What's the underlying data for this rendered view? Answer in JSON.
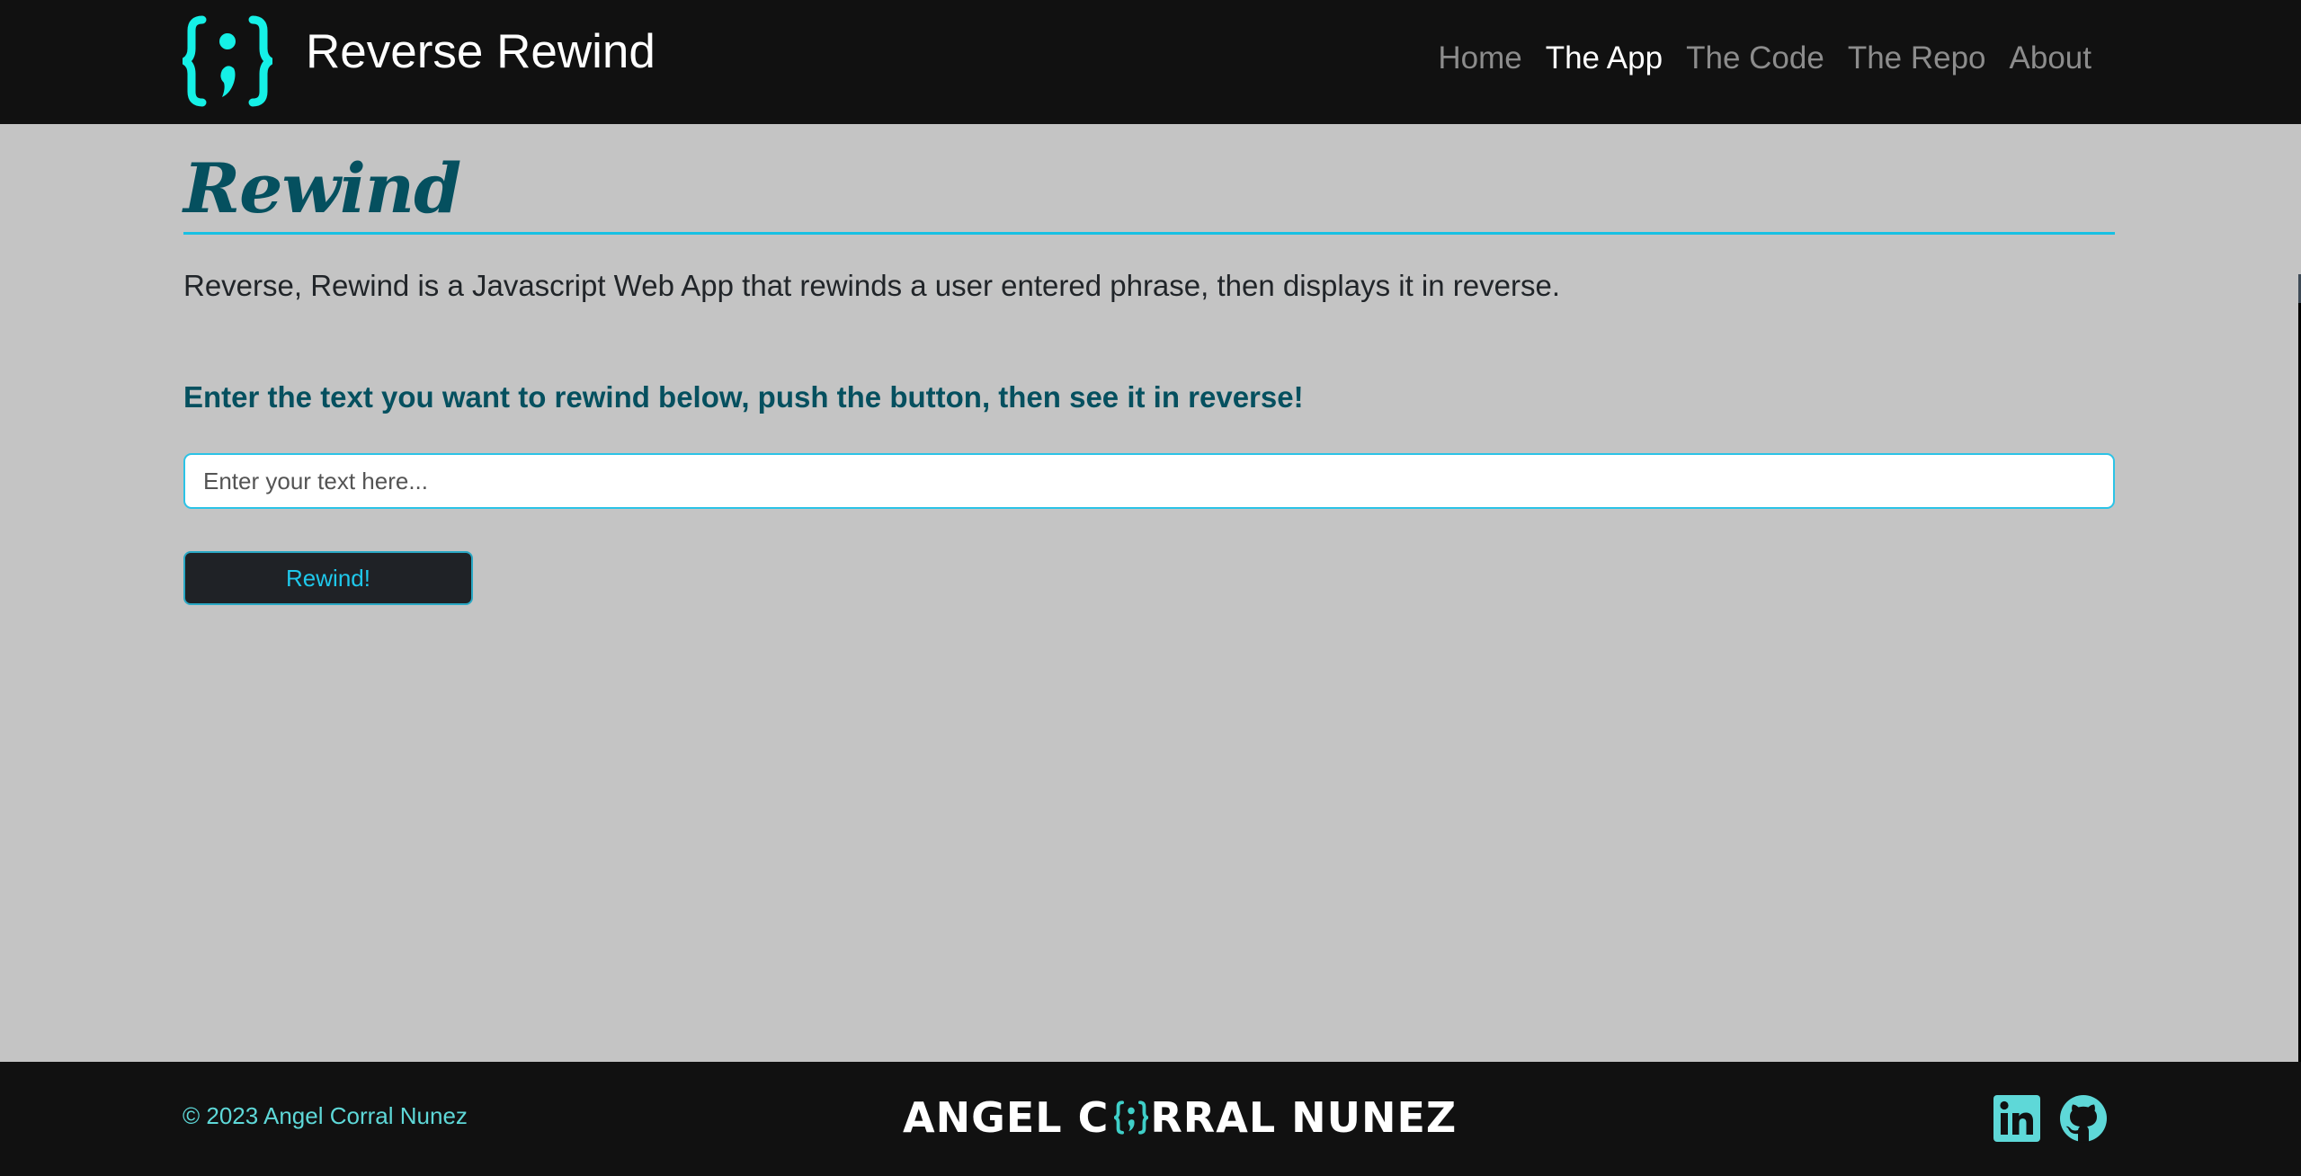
{
  "navbar": {
    "brand_name": "Reverse Rewind",
    "logo_icon": "curly-braces-semicolon-icon",
    "links": [
      {
        "label": "Home",
        "active": false
      },
      {
        "label": "The App",
        "active": true
      },
      {
        "label": "The Code",
        "active": false
      },
      {
        "label": "The Repo",
        "active": false
      },
      {
        "label": "About",
        "active": false
      }
    ]
  },
  "main": {
    "title": "Rewind",
    "intro": "Reverse, Rewind is a Javascript Web App that rewinds a user entered phrase, then displays it in reverse.",
    "prompt": "Enter the text you want to rewind below, push the button, then see it in reverse!",
    "input": {
      "value": "",
      "placeholder": "Enter your text here..."
    },
    "button_label": "Rewind!"
  },
  "footer": {
    "copyright": "© 2023 Angel Corral Nunez",
    "brand_left": "ANGEL C",
    "brand_right": "RRAL NUNEZ",
    "social": [
      {
        "name": "LinkedIn",
        "icon": "linkedin-icon"
      },
      {
        "name": "GitHub",
        "icon": "github-icon"
      }
    ]
  },
  "colors": {
    "accent": "#17c0e3",
    "logo": "#15f0e6",
    "title": "#05505f",
    "footer_accent": "#5ed8d8",
    "background": "#c4c4c4",
    "bar": "#111111"
  }
}
